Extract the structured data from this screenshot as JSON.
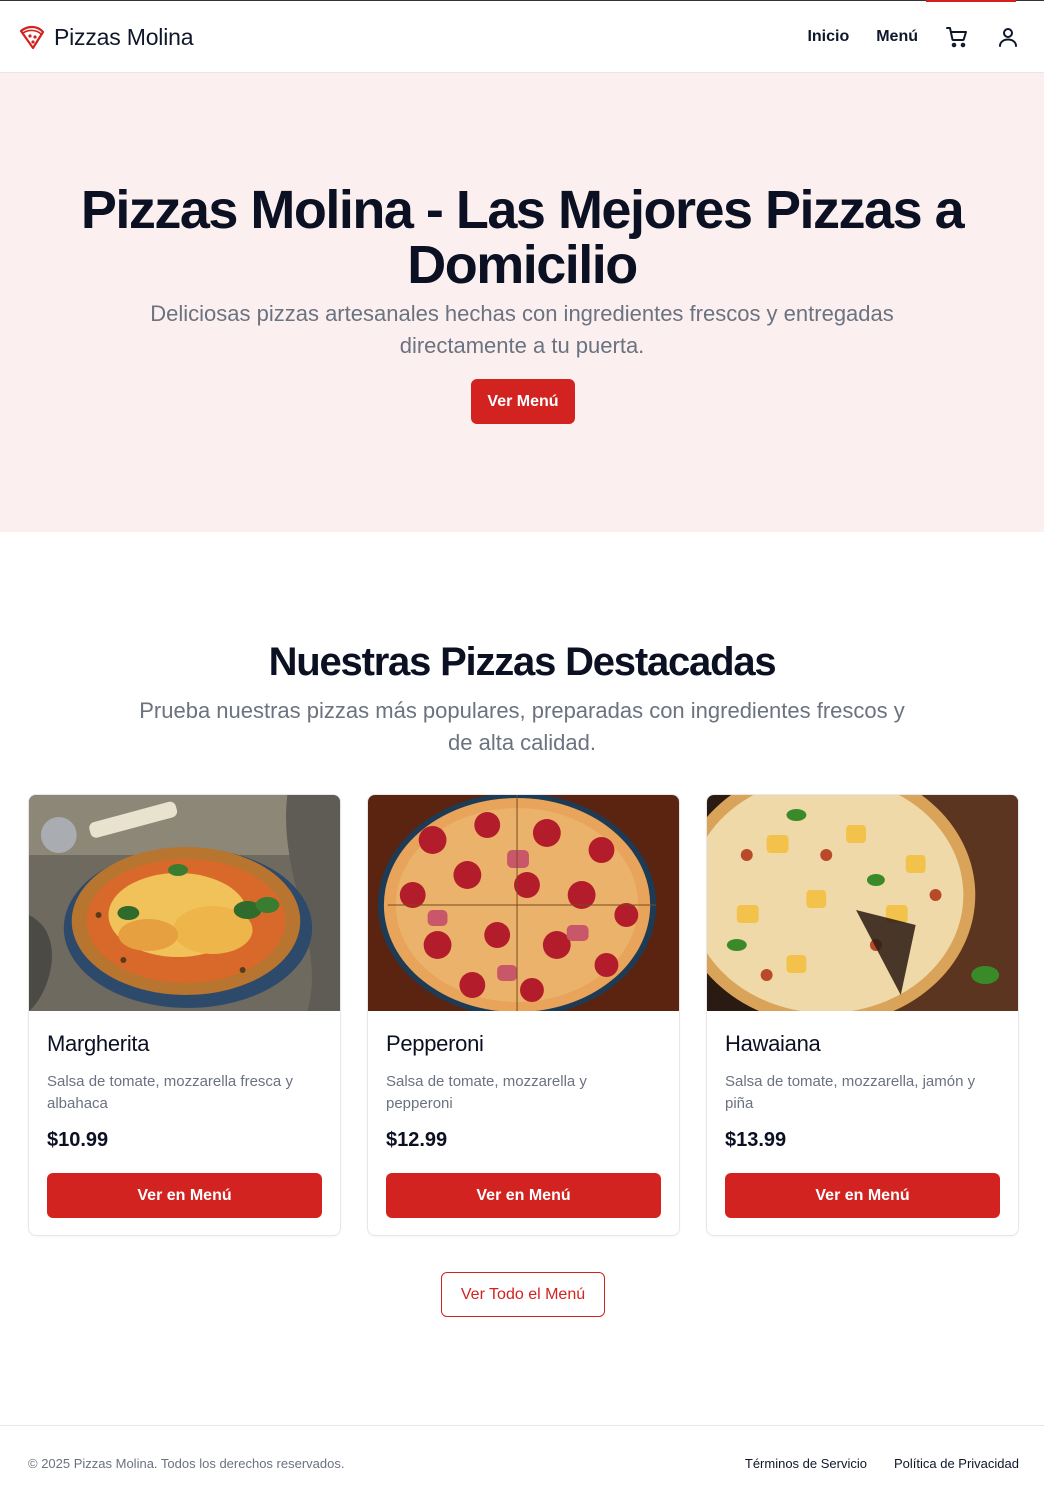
{
  "header": {
    "brand": "Pizzas Molina",
    "nav": [
      {
        "label": "Inicio"
      },
      {
        "label": "Menú"
      }
    ],
    "icons": [
      "cart-icon",
      "user-icon"
    ]
  },
  "hero": {
    "title": "Pizzas Molina - Las Mejores Pizzas a Domicilio",
    "subtitle": "Deliciosas pizzas artesanales hechas con ingredientes frescos y entregadas directamente a tu puerta.",
    "button": "Ver Menú"
  },
  "featured": {
    "title": "Nuestras Pizzas Destacadas",
    "subtitle": "Prueba nuestras pizzas más populares, preparadas con ingredientes frescos y de alta calidad.",
    "pizzas": [
      {
        "name": "Margherita",
        "description": "Salsa de tomate, mozzarella fresca y albahaca",
        "price": "$10.99",
        "button": "Ver en Menú"
      },
      {
        "name": "Pepperoni",
        "description": "Salsa de tomate, mozzarella y pepperoni",
        "price": "$12.99",
        "button": "Ver en Menú"
      },
      {
        "name": "Hawaiana",
        "description": "Salsa de tomate, mozzarella, jamón y piña",
        "price": "$13.99",
        "button": "Ver en Menú"
      }
    ],
    "all_button": "Ver Todo el Menú"
  },
  "footer": {
    "copyright": "© 2025 Pizzas Molina. Todos los derechos reservados.",
    "links": [
      {
        "label": "Términos de Servicio"
      },
      {
        "label": "Política de Privacidad"
      }
    ]
  },
  "colors": {
    "accent": "#d32320",
    "hero_bg": "#fbf0ef",
    "text_dark": "#0b1022",
    "text_muted": "#6b7280"
  }
}
